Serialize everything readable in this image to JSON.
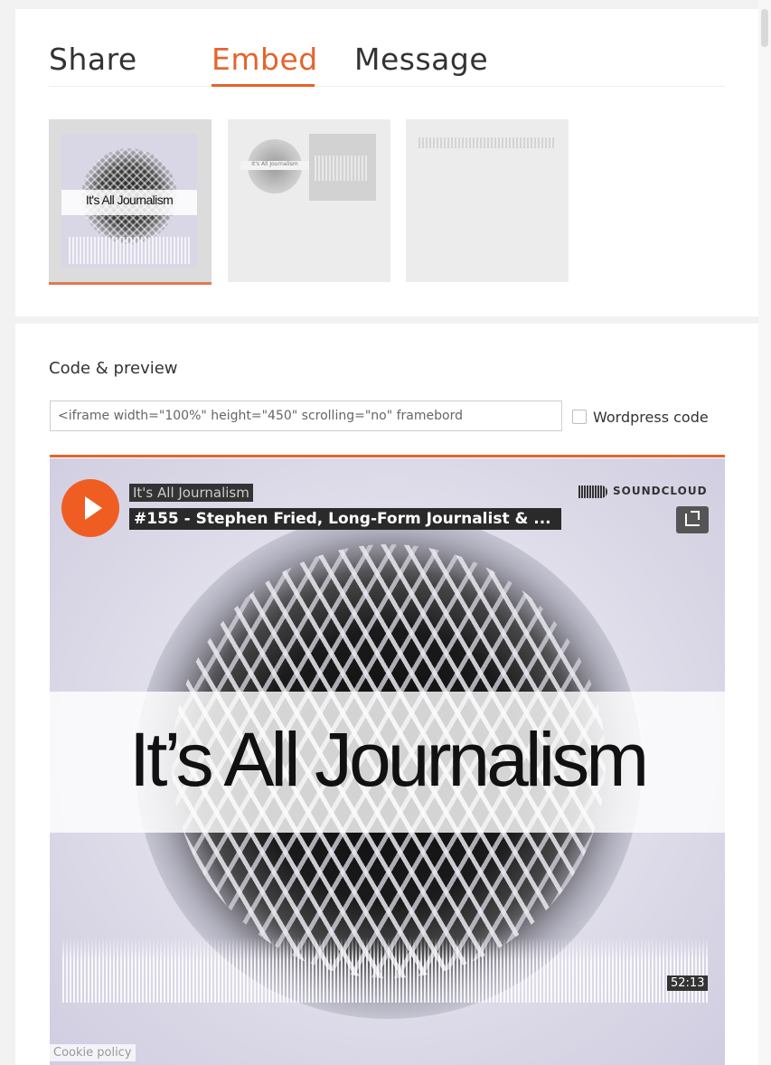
{
  "tabs": [
    {
      "label": "Share",
      "active": false
    },
    {
      "label": "Embed",
      "active": true
    },
    {
      "label": "Message",
      "active": false
    }
  ],
  "widget_options": {
    "visual_thumb_title": "It's All Journalism",
    "classic_thumb_title": "It's All Journalism"
  },
  "code_preview": {
    "label": "Code & preview",
    "embed_code": "<iframe width=\"100%\" height=\"450\" scrolling=\"no\" framebord",
    "wordpress_label": "Wordpress code",
    "wordpress_checked": false
  },
  "player": {
    "artist": "It's All Journalism",
    "track": "#155 - Stephen Fried, Long-Form Journalist & ...",
    "brand": "SOUNDCLOUD",
    "artwork_title": "It’s All Journalism",
    "duration": "52:13",
    "cookie_policy": "Cookie policy"
  },
  "colors": {
    "accent": "#e6642d",
    "play_button": "#f05d23"
  },
  "icons": [
    "play-icon",
    "soundcloud-logo-icon",
    "share-icon"
  ]
}
